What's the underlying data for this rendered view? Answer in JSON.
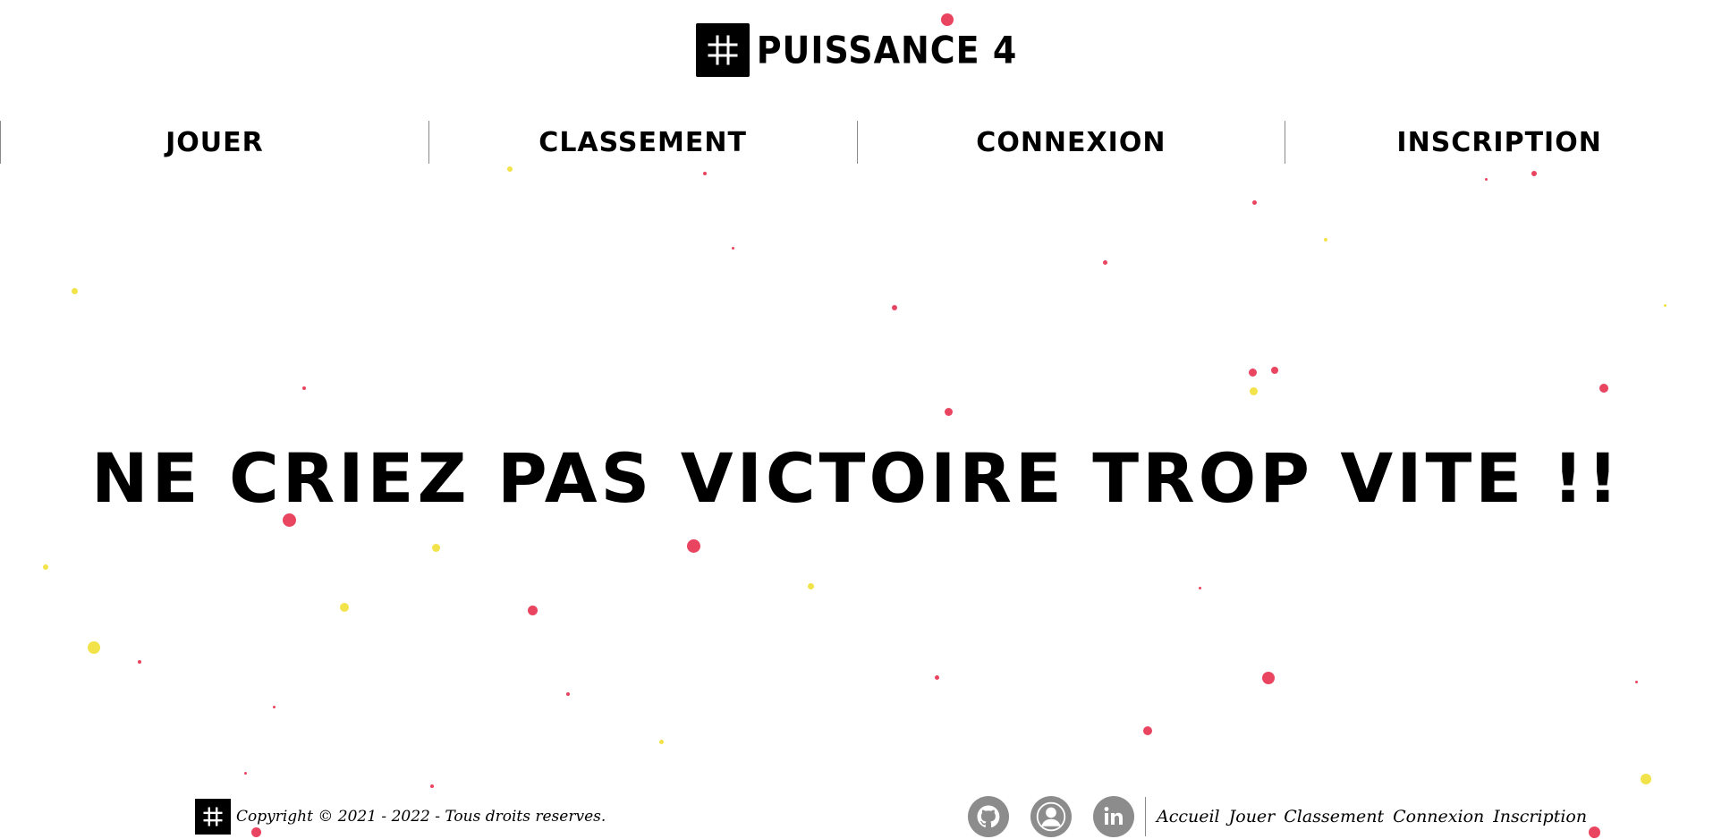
{
  "brand": {
    "title": "PUISSANCE 4",
    "logo_icon": "hash-icon"
  },
  "nav": {
    "items": [
      {
        "label": "JOUER"
      },
      {
        "label": "CLASSEMENT"
      },
      {
        "label": "CONNEXION"
      },
      {
        "label": "INSCRIPTION"
      }
    ]
  },
  "hero": {
    "text": "NE CRIEZ PAS VICTOIRE TROP VITE !!"
  },
  "footer": {
    "copyright": "Copyright © 2021 - 2022 - Tous droits reserves.",
    "social": [
      {
        "icon": "github-icon"
      },
      {
        "icon": "user-icon"
      },
      {
        "icon": "linkedin-icon"
      }
    ],
    "links": [
      "Accueil",
      "Jouer",
      "Classement",
      "Connexion",
      "Inscription"
    ]
  },
  "colors": {
    "red_dot": "#e94560",
    "yellow_dot": "#f2e34a",
    "text": "#000000",
    "icon_grey": "#8c8c8c"
  }
}
